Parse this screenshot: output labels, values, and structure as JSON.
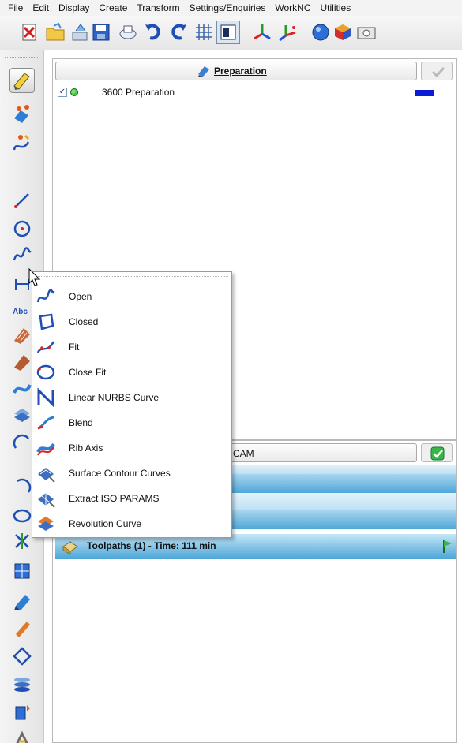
{
  "menubar": {
    "items": [
      "File",
      "Edit",
      "Display",
      "Create",
      "Transform",
      "Settings/Enquiries",
      "WorkNC",
      "Utilities"
    ]
  },
  "toolbar": {
    "icons": [
      "delete-icon",
      "open-folder-icon",
      "import-icon",
      "save-icon",
      "print-icon",
      "undo-icon",
      "redo-icon",
      "grid-icon",
      "view-panel-icon",
      "axis-icon",
      "axis-alt-icon",
      "sphere-icon",
      "cube-icon",
      "camera-icon"
    ]
  },
  "left_toolbar": {
    "icons": [
      "select-icon",
      "surface-tools-icon",
      "curve-tools-icon",
      "line-icon",
      "circle-icon",
      "spline-icon",
      "dimension-icon",
      "text-icon",
      "hatch-icon",
      "offset-icon",
      "blend-surface-icon",
      "layers-icon",
      "arc-icon",
      "revolve-icon",
      "trim-icon",
      "solid-icon",
      "shape-icon",
      "pencil-icon",
      "plane-icon",
      "stack-icon",
      "database-icon",
      "tool-icon"
    ]
  },
  "preparation": {
    "title": "Preparation",
    "row": {
      "label": "3600  Preparation",
      "checked": true,
      "color": "#0b1bd6"
    }
  },
  "cam": {
    "title": "CAM",
    "toolpaths_label": "Toolpaths (1) - Time: 111 min"
  },
  "context_menu": {
    "items": [
      {
        "label": "Open",
        "icon": "open-curve-icon"
      },
      {
        "label": "Closed",
        "icon": "closed-curve-icon"
      },
      {
        "label": "Fit",
        "icon": "fit-curve-icon"
      },
      {
        "label": "Close Fit",
        "icon": "close-fit-icon"
      },
      {
        "label": "Linear NURBS Curve",
        "icon": "nurbs-curve-icon"
      },
      {
        "label": "Blend",
        "icon": "blend-icon"
      },
      {
        "label": "Rib Axis",
        "icon": "rib-axis-icon"
      },
      {
        "label": "Surface Contour Curves",
        "icon": "surface-contour-icon"
      },
      {
        "label": "Extract ISO PARAMS",
        "icon": "extract-iso-icon"
      },
      {
        "label": "Revolution Curve",
        "icon": "revolution-curve-icon"
      }
    ]
  },
  "colors": {
    "accent_blue": "#4ea8d8",
    "band_light": "#bde0f4",
    "curve_blue": "#1f4fb4"
  }
}
